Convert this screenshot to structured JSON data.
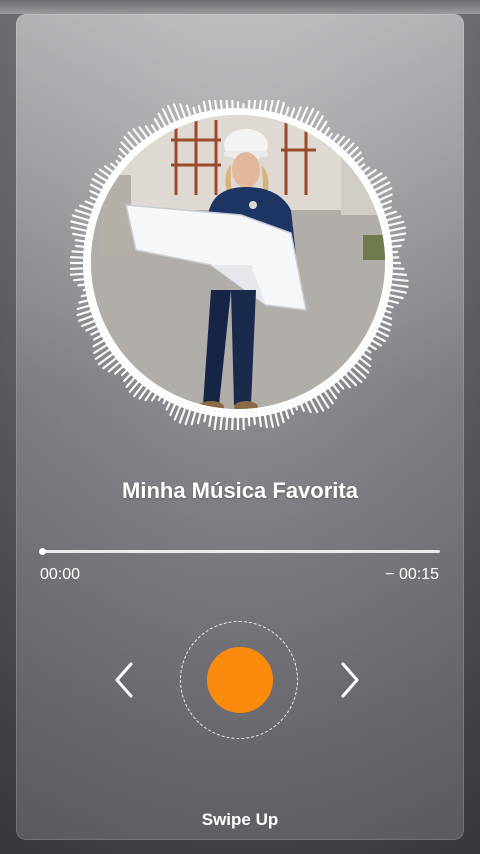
{
  "player": {
    "song_title": "Minha Música Favorita",
    "time_elapsed": "00:00",
    "time_remaining": "− 00:15",
    "progress": 0.0,
    "accent_color": "#fb8b0c",
    "artwork_description": "woman-in-hard-hat-holding-blueprint",
    "prev_icon": "chevron-left-icon",
    "next_icon": "chevron-right-icon"
  },
  "footer": {
    "swipe_label": "Swipe Up"
  }
}
